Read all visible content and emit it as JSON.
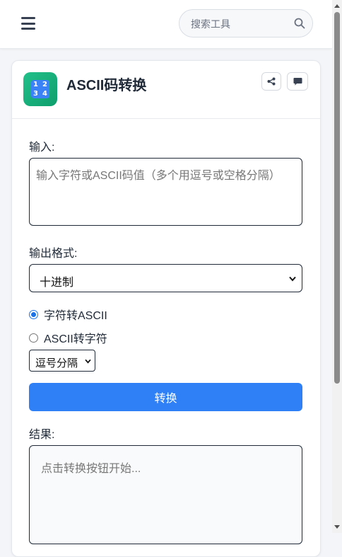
{
  "topbar": {
    "menu_icon": "hamburger-menu-icon",
    "search": {
      "placeholder": "搜索工具",
      "icon": "search-icon"
    }
  },
  "tool": {
    "icon": "numbers-1234-icon",
    "icon_digits": [
      "1",
      "2",
      "3",
      "4"
    ],
    "title": "ASCII码转换",
    "share_icon": "share-icon",
    "comment_icon": "comment-icon"
  },
  "form": {
    "input_label": "输入:",
    "input_placeholder": "输入字符或ASCII码值（多个用逗号或空格分隔）",
    "output_format_label": "输出格式:",
    "output_format_selected": "十进制",
    "mode_options": [
      {
        "label": "字符转ASCII",
        "checked": true
      },
      {
        "label": "ASCII转字符",
        "checked": false
      }
    ],
    "separator_selected": "逗号分隔",
    "convert_button": "转换",
    "result_label": "结果:",
    "result_placeholder": "点击转换按钮开始..."
  },
  "colors": {
    "primary": "#2f80f6",
    "tool_icon_bg": "#14a874",
    "radio_accent": "#1a73e8"
  }
}
